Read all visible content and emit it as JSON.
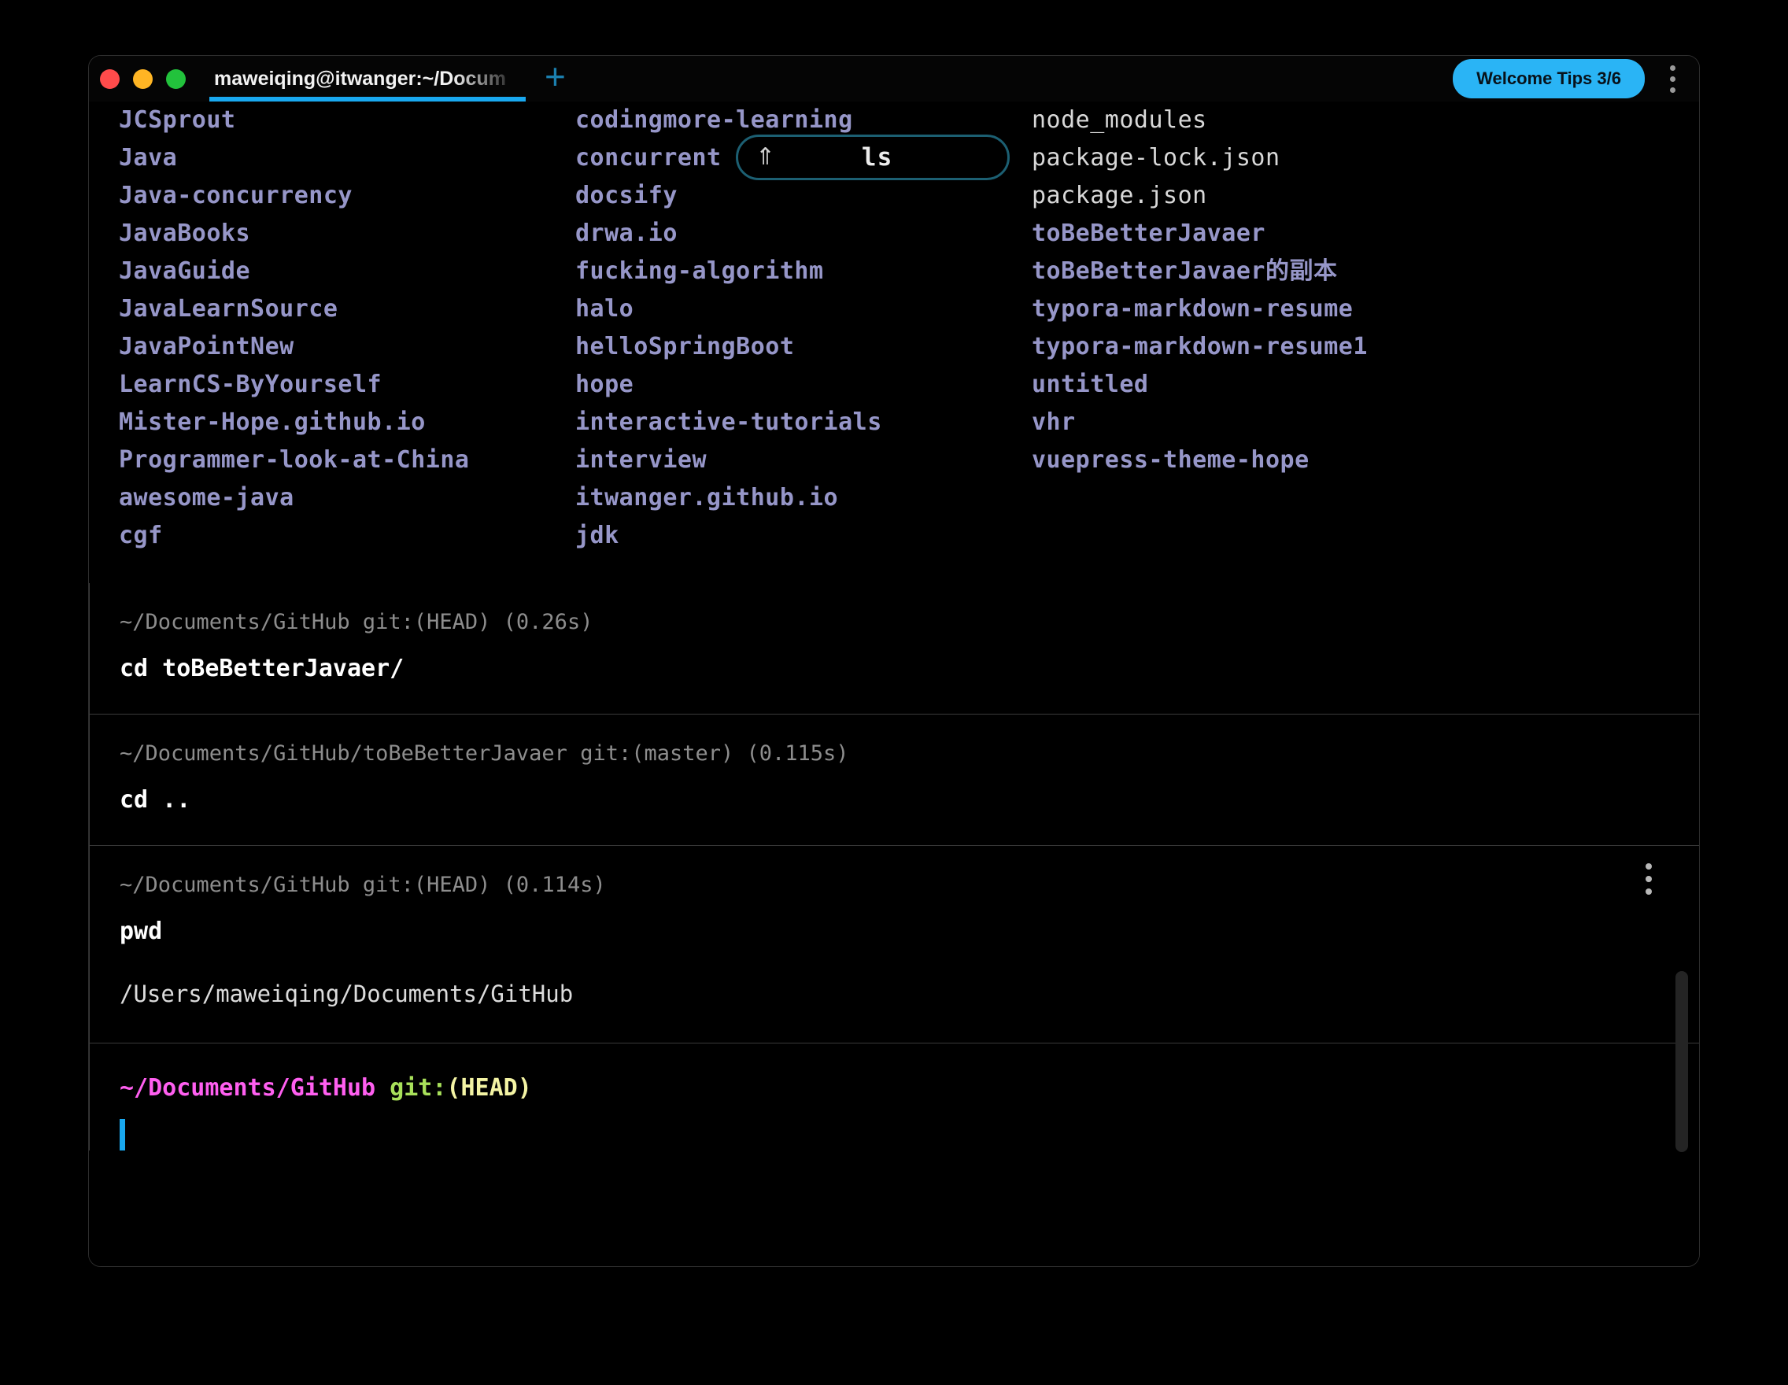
{
  "window": {
    "traffic_lights": [
      {
        "name": "close",
        "color": "#ff4b4b"
      },
      {
        "name": "minimize",
        "color": "#ffb524"
      },
      {
        "name": "maximize",
        "color": "#22c23c"
      }
    ],
    "accent_color": "#19a8ef"
  },
  "titlebar": {
    "tab_title": "maweiqing@itwanger:~/Docum",
    "new_tab_icon": "plus-icon",
    "welcome_tips_label": "Welcome Tips 3/6",
    "welcome_tips_color": "#2ab4f5",
    "menu_icon": "vertical-dots-icon"
  },
  "hint_pill": {
    "modifier_icon": "chevron-up-icon",
    "modifier_glyph": "⇑",
    "command": "ls",
    "border_color": "#1c5f72"
  },
  "ls_block": {
    "columns": [
      [
        {
          "name": "JCSprout",
          "type": "dir"
        },
        {
          "name": "Java",
          "type": "dir"
        },
        {
          "name": "Java-concurrency",
          "type": "dir"
        },
        {
          "name": "JavaBooks",
          "type": "dir"
        },
        {
          "name": "JavaGuide",
          "type": "dir"
        },
        {
          "name": "JavaLearnSource",
          "type": "dir"
        },
        {
          "name": "JavaPointNew",
          "type": "dir"
        },
        {
          "name": "LearnCS-ByYourself",
          "type": "dir"
        },
        {
          "name": "Mister-Hope.github.io",
          "type": "dir"
        },
        {
          "name": "Programmer-look-at-China",
          "type": "dir"
        },
        {
          "name": "awesome-java",
          "type": "dir"
        },
        {
          "name": "cgf",
          "type": "dir"
        }
      ],
      [
        {
          "name": "codingmore-learning",
          "type": "dir"
        },
        {
          "name": "concurrent",
          "type": "dir"
        },
        {
          "name": "docsify",
          "type": "dir"
        },
        {
          "name": "drwa.io",
          "type": "dir"
        },
        {
          "name": "fucking-algorithm",
          "type": "dir"
        },
        {
          "name": "halo",
          "type": "dir"
        },
        {
          "name": "helloSpringBoot",
          "type": "dir"
        },
        {
          "name": "hope",
          "type": "dir"
        },
        {
          "name": "interactive-tutorials",
          "type": "dir"
        },
        {
          "name": "interview",
          "type": "dir"
        },
        {
          "name": "itwanger.github.io",
          "type": "dir"
        },
        {
          "name": "jdk",
          "type": "dir"
        }
      ],
      [
        {
          "name": "node_modules",
          "type": "file"
        },
        {
          "name": "package-lock.json",
          "type": "file"
        },
        {
          "name": "package.json",
          "type": "file"
        },
        {
          "name": "toBeBetterJavaer",
          "type": "dir"
        },
        {
          "name": "toBeBetterJavaer的副本",
          "type": "dir"
        },
        {
          "name": "typora-markdown-resume",
          "type": "dir"
        },
        {
          "name": "typora-markdown-resume1",
          "type": "dir"
        },
        {
          "name": "untitled",
          "type": "dir"
        },
        {
          "name": "vhr",
          "type": "dir"
        },
        {
          "name": "vuepress-theme-hope",
          "type": "dir"
        }
      ]
    ]
  },
  "blocks": [
    {
      "prompt": "~/Documents/GitHub git:(HEAD) (0.26s)",
      "command": "cd toBeBetterJavaer/",
      "output": ""
    },
    {
      "prompt": "~/Documents/GitHub/toBeBetterJavaer git:(master) (0.115s)",
      "command": "cd ..",
      "output": ""
    },
    {
      "prompt": "~/Documents/GitHub git:(HEAD) (0.114s)",
      "command": "pwd",
      "output": "/Users/maweiqing/Documents/GitHub",
      "menu_icon": "vertical-dots-icon"
    }
  ],
  "active_prompt": {
    "path": "~/Documents/GitHub ",
    "git_label": "git:",
    "branch": "(HEAD)",
    "input_value": "",
    "cursor_color": "#19a8ef"
  }
}
